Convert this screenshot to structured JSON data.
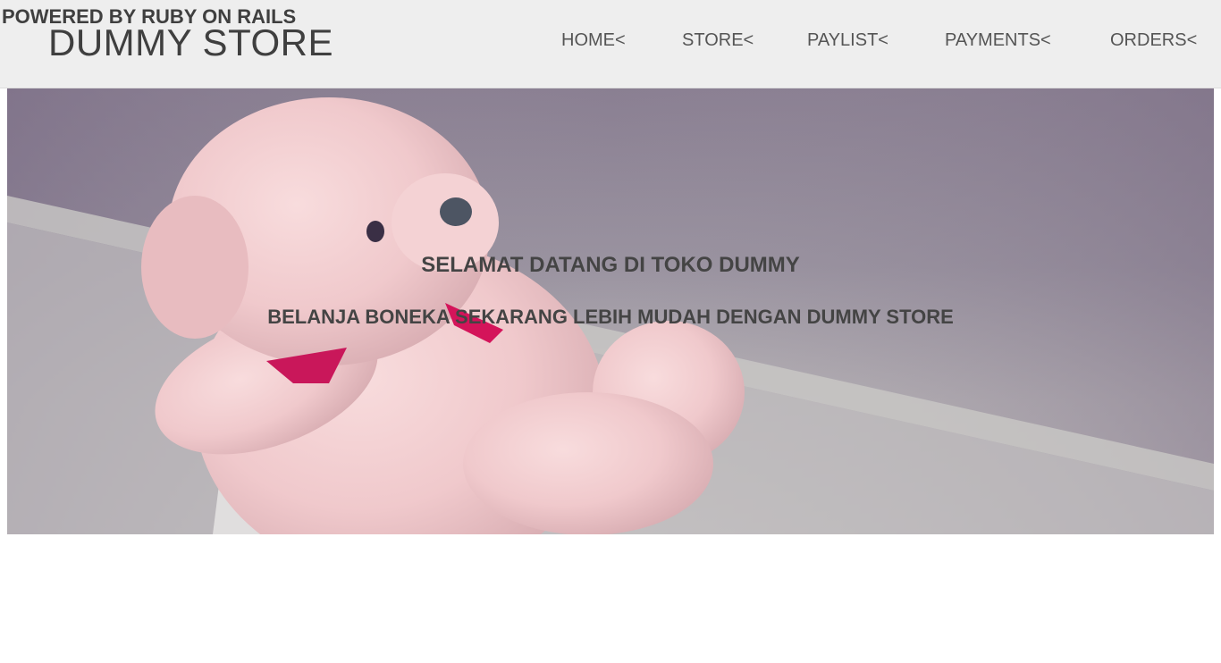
{
  "header": {
    "powered_by": "POWERED BY RUBY ON RAILS",
    "brand": "DUMMY STORE",
    "nav": [
      {
        "label": "HOME<"
      },
      {
        "label": "STORE<"
      },
      {
        "label": "PAYLIST<"
      },
      {
        "label": "PAYMENTS<"
      },
      {
        "label": "ORDERS<"
      }
    ]
  },
  "hero": {
    "image": "pink-teddy-bear-photo",
    "title": "SELAMAT DATANG DI TOKO DUMMY",
    "subtitle": "BELANJA BONEKA SEKARANG LEBIH MUDAH DENGAN DUMMY STORE"
  },
  "colors": {
    "header_bg": "#eeeeee",
    "text": "#444444",
    "bow": "#d4145a",
    "bear": "#f1cdd0"
  }
}
